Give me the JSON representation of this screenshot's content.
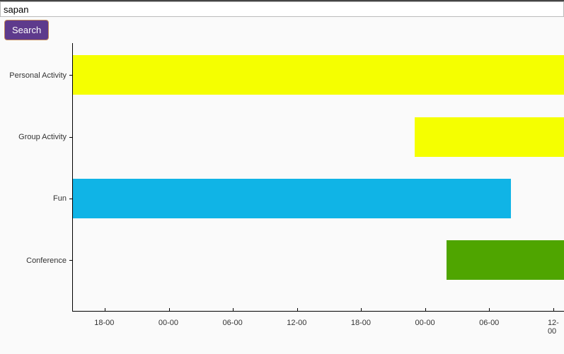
{
  "search": {
    "value": "sapan",
    "placeholder": "",
    "button_label": "Search"
  },
  "chart_data": {
    "type": "bar",
    "orientation": "horizontal",
    "x_axis_type": "time",
    "categories": [
      "Personal Activity",
      "Group Activity",
      "Fun",
      "Conference"
    ],
    "x_ticks": [
      "18-00",
      "00-00",
      "06-00",
      "12-00",
      "18-00",
      "00-00",
      "06-00",
      "12-00"
    ],
    "x_range_hours": [
      15,
      61
    ],
    "series": [
      {
        "name": "Personal Activity",
        "start_h": 15,
        "end_h": 61,
        "color": "#f5ff00"
      },
      {
        "name": "Group Activity",
        "start_h": 47,
        "end_h": 61,
        "color": "#f5ff00"
      },
      {
        "name": "Fun",
        "start_h": 15,
        "end_h": 56,
        "color": "#10b4e6"
      },
      {
        "name": "Conference",
        "start_h": 50,
        "end_h": 61,
        "color": "#4fa500"
      }
    ],
    "row_centers_pct": [
      12,
      35,
      58,
      81
    ]
  }
}
